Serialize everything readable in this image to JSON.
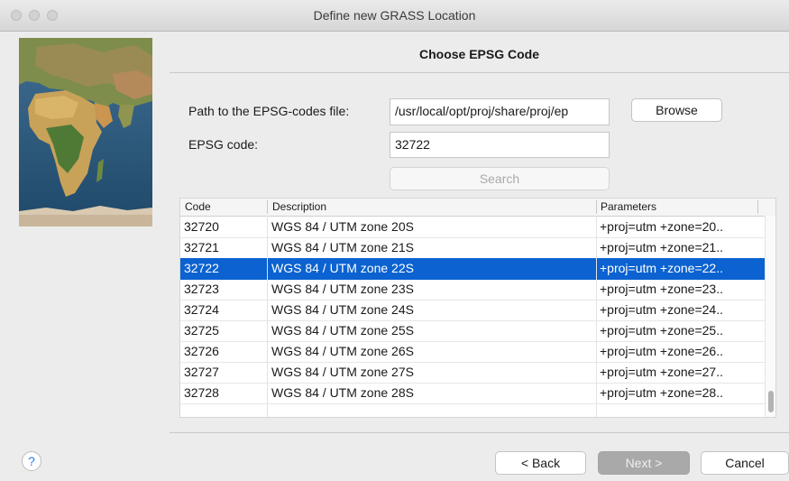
{
  "window": {
    "title": "Define new GRASS Location"
  },
  "page": {
    "heading": "Choose EPSG Code"
  },
  "form": {
    "path_label": "Path to the EPSG-codes file:",
    "path_value": "/usr/local/opt/proj/share/proj/ep",
    "browse_label": "Browse",
    "code_label": "EPSG code:",
    "code_value": "32722",
    "search_label": "Search"
  },
  "table": {
    "columns": [
      "Code",
      "Description",
      "Parameters"
    ],
    "selected_code": "32722",
    "rows": [
      {
        "code": "32720",
        "description": "WGS 84 / UTM zone 20S",
        "parameters": "+proj=utm +zone=20.."
      },
      {
        "code": "32721",
        "description": "WGS 84 / UTM zone 21S",
        "parameters": "+proj=utm +zone=21.."
      },
      {
        "code": "32722",
        "description": "WGS 84 / UTM zone 22S",
        "parameters": "+proj=utm +zone=22.."
      },
      {
        "code": "32723",
        "description": "WGS 84 / UTM zone 23S",
        "parameters": "+proj=utm +zone=23.."
      },
      {
        "code": "32724",
        "description": "WGS 84 / UTM zone 24S",
        "parameters": "+proj=utm +zone=24.."
      },
      {
        "code": "32725",
        "description": "WGS 84 / UTM zone 25S",
        "parameters": "+proj=utm +zone=25.."
      },
      {
        "code": "32726",
        "description": "WGS 84 / UTM zone 26S",
        "parameters": "+proj=utm +zone=26.."
      },
      {
        "code": "32727",
        "description": "WGS 84 / UTM zone 27S",
        "parameters": "+proj=utm +zone=27.."
      },
      {
        "code": "32728",
        "description": "WGS 84 / UTM zone 28S",
        "parameters": "+proj=utm +zone=28.."
      }
    ]
  },
  "footer": {
    "help_label": "?",
    "back_label": "< Back",
    "next_label": "Next >",
    "cancel_label": "Cancel"
  },
  "colors": {
    "selection": "#0b62d0",
    "help_icon": "#2a7df6"
  },
  "icons": {
    "help": "help-icon",
    "window_close": "close-traffic-light-icon",
    "window_minimize": "minimize-traffic-light-icon",
    "window_zoom": "zoom-traffic-light-icon",
    "map": "world-map-image"
  }
}
